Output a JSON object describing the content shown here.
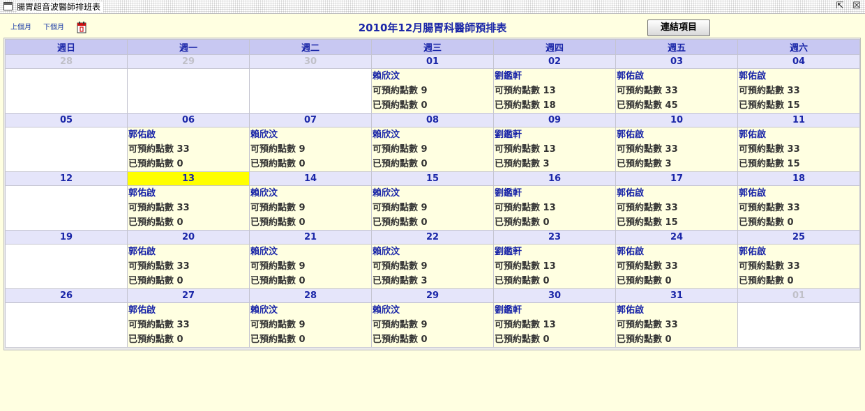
{
  "window": {
    "title": "腸胃超音波醫師排班表"
  },
  "nav": {
    "prev_label": "上個月",
    "next_label": "下個月"
  },
  "page": {
    "title": "2010年12月腸胃科醫師預排表"
  },
  "toolbar": {
    "link_button_label": "連結項目"
  },
  "calendar": {
    "weekdays": [
      "週日",
      "週一",
      "週二",
      "週三",
      "週四",
      "週五",
      "週六"
    ],
    "available_label": "可預約點數",
    "booked_label": "已預約點數",
    "weeks": [
      [
        {
          "date": "28",
          "other": true
        },
        {
          "date": "29",
          "other": true
        },
        {
          "date": "30",
          "other": true
        },
        {
          "date": "01",
          "doctor": "賴欣汶",
          "available": 9,
          "booked": 0
        },
        {
          "date": "02",
          "doctor": "劉鑑軒",
          "available": 13,
          "booked": 18
        },
        {
          "date": "03",
          "doctor": "郭佑啟",
          "available": 33,
          "booked": 45
        },
        {
          "date": "04",
          "doctor": "郭佑啟",
          "available": 33,
          "booked": 15
        }
      ],
      [
        {
          "date": "05"
        },
        {
          "date": "06",
          "doctor": "郭佑啟",
          "available": 33,
          "booked": 0
        },
        {
          "date": "07",
          "doctor": "賴欣汶",
          "available": 9,
          "booked": 0
        },
        {
          "date": "08",
          "doctor": "賴欣汶",
          "available": 9,
          "booked": 0
        },
        {
          "date": "09",
          "doctor": "劉鑑軒",
          "available": 13,
          "booked": 3
        },
        {
          "date": "10",
          "doctor": "郭佑啟",
          "available": 33,
          "booked": 3
        },
        {
          "date": "11",
          "doctor": "郭佑啟",
          "available": 33,
          "booked": 15
        }
      ],
      [
        {
          "date": "12"
        },
        {
          "date": "13",
          "today": true,
          "doctor": "郭佑啟",
          "available": 33,
          "booked": 0
        },
        {
          "date": "14",
          "doctor": "賴欣汶",
          "available": 9,
          "booked": 0
        },
        {
          "date": "15",
          "doctor": "賴欣汶",
          "available": 9,
          "booked": 0
        },
        {
          "date": "16",
          "doctor": "劉鑑軒",
          "available": 13,
          "booked": 0
        },
        {
          "date": "17",
          "doctor": "郭佑啟",
          "available": 33,
          "booked": 15
        },
        {
          "date": "18",
          "doctor": "郭佑啟",
          "available": 33,
          "booked": 0
        }
      ],
      [
        {
          "date": "19"
        },
        {
          "date": "20",
          "doctor": "郭佑啟",
          "available": 33,
          "booked": 0
        },
        {
          "date": "21",
          "doctor": "賴欣汶",
          "available": 9,
          "booked": 0
        },
        {
          "date": "22",
          "doctor": "賴欣汶",
          "available": 9,
          "booked": 3
        },
        {
          "date": "23",
          "doctor": "劉鑑軒",
          "available": 13,
          "booked": 0
        },
        {
          "date": "24",
          "doctor": "郭佑啟",
          "available": 33,
          "booked": 0
        },
        {
          "date": "25",
          "doctor": "郭佑啟",
          "available": 33,
          "booked": 0
        }
      ],
      [
        {
          "date": "26"
        },
        {
          "date": "27",
          "doctor": "郭佑啟",
          "available": 33,
          "booked": 0
        },
        {
          "date": "28",
          "doctor": "賴欣汶",
          "available": 9,
          "booked": 0
        },
        {
          "date": "29",
          "doctor": "賴欣汶",
          "available": 9,
          "booked": 0
        },
        {
          "date": "30",
          "doctor": "劉鑑軒",
          "available": 13,
          "booked": 0
        },
        {
          "date": "31",
          "doctor": "郭佑啟",
          "available": 33,
          "booked": 0
        },
        {
          "date": "01",
          "other": true
        }
      ]
    ]
  }
}
